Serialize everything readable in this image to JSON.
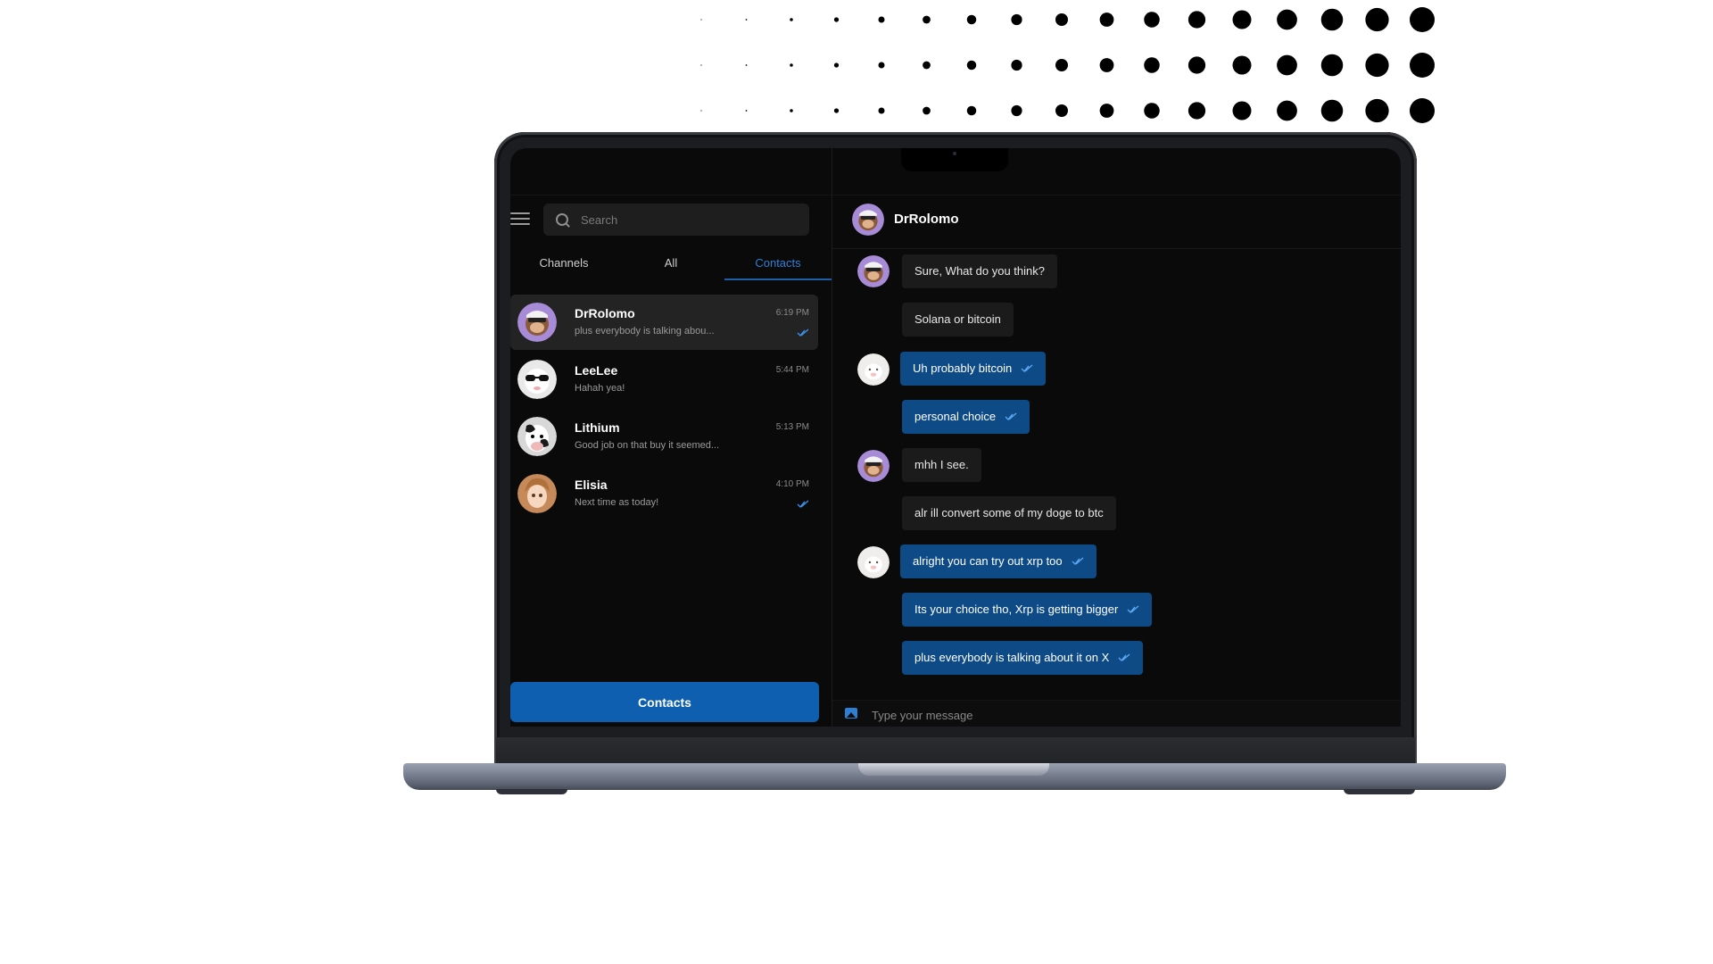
{
  "sidebar": {
    "search": {
      "placeholder": "Search"
    },
    "tabs": [
      {
        "label": "Channels",
        "active": false
      },
      {
        "label": "All",
        "active": false
      },
      {
        "label": "Contacts",
        "active": true
      }
    ],
    "contacts": [
      {
        "name": "DrRolomo",
        "preview": "plus everybody is talking abou...",
        "time": "6:19 PM",
        "read": true,
        "selected": true,
        "avatar": "monkey-avatar"
      },
      {
        "name": "LeeLee",
        "preview": "Hahah yea!",
        "time": "5:44 PM",
        "read": false,
        "selected": false,
        "avatar": "sunglasses-avatar"
      },
      {
        "name": "Lithium",
        "preview": "Good job on that buy it seemed...",
        "time": "5:13 PM",
        "read": false,
        "selected": false,
        "avatar": "cow-avatar"
      },
      {
        "name": "Elisia",
        "preview": "Next time as today!",
        "time": "4:10 PM",
        "read": true,
        "selected": false,
        "avatar": "anime-girl-avatar"
      }
    ],
    "contacts_button": "Contacts"
  },
  "chat": {
    "header_name": "DrRolomo",
    "messages": [
      {
        "text": "Sure, What do you think?",
        "direction": "in"
      },
      {
        "text": "Solana or bitcoin",
        "direction": "in"
      },
      {
        "text": "Uh probably bitcoin",
        "direction": "out",
        "read": true
      },
      {
        "text": "personal choice",
        "direction": "out",
        "read": true
      },
      {
        "text": "mhh I see.",
        "direction": "in"
      },
      {
        "text": "alr ill convert some of my doge to btc",
        "direction": "in"
      },
      {
        "text": "alright you can try out xrp too",
        "direction": "out",
        "read": true
      },
      {
        "text": "Its your choice tho, Xrp is getting bigger",
        "direction": "out",
        "read": true
      },
      {
        "text": "plus everybody is talking about it on X",
        "direction": "out",
        "read": true
      }
    ],
    "composer_placeholder": "Type your message"
  },
  "colors": {
    "accent": "#0f5fb0",
    "outgoing_bubble": "#0d4a86",
    "incoming_bubble": "#1b1b1b",
    "background": "#0a0a0a"
  }
}
